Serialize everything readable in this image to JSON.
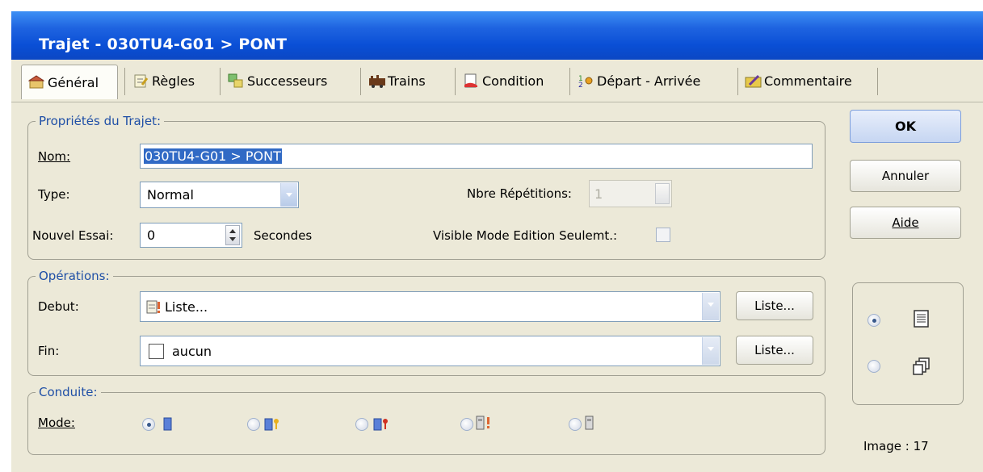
{
  "window": {
    "title": "Trajet - 030TU4-G01 > PONT"
  },
  "tabs": [
    {
      "label": "Général",
      "icon": "general-properties-icon"
    },
    {
      "label": "Règles",
      "icon": "rules-icon"
    },
    {
      "label": "Successeurs",
      "icon": "successors-icon"
    },
    {
      "label": "Trains",
      "icon": "trains-icon"
    },
    {
      "label": "Condition",
      "icon": "condition-icon"
    },
    {
      "label": "Départ - Arrivée",
      "icon": "departure-arrival-icon"
    },
    {
      "label": "Commentaire",
      "icon": "comment-icon"
    }
  ],
  "proprietes": {
    "legend": "Propriétés du Trajet:",
    "nom_label": "Nom:",
    "nom_value": "030TU4-G01 > PONT",
    "type_label": "Type:",
    "type_value": "Normal",
    "repetitions_label": "Nbre Répétitions:",
    "repetitions_value": "1",
    "essai_label": "Nouvel Essai:",
    "essai_value": "0",
    "essai_unit": "Secondes",
    "visible_label": "Visible Mode Edition Seulemt.:",
    "visible_checked": false
  },
  "operations": {
    "legend": "Opérations:",
    "debut_label": "Debut:",
    "debut_value": "Liste...",
    "fin_label": "Fin:",
    "fin_value": "aucun",
    "liste_button": "Liste..."
  },
  "conduite": {
    "legend": "Conduite:",
    "mode_label": "Mode:",
    "selected_mode": 0
  },
  "buttons": {
    "ok": "OK",
    "annuler": "Annuler",
    "aide": "Aide"
  },
  "view": {
    "selected": "list"
  },
  "status": {
    "image": "Image : 17"
  },
  "colors": {
    "title_bar": "#0a4fd6",
    "legend_text": "#1f4fa6",
    "window_bg": "#ece9d8"
  }
}
